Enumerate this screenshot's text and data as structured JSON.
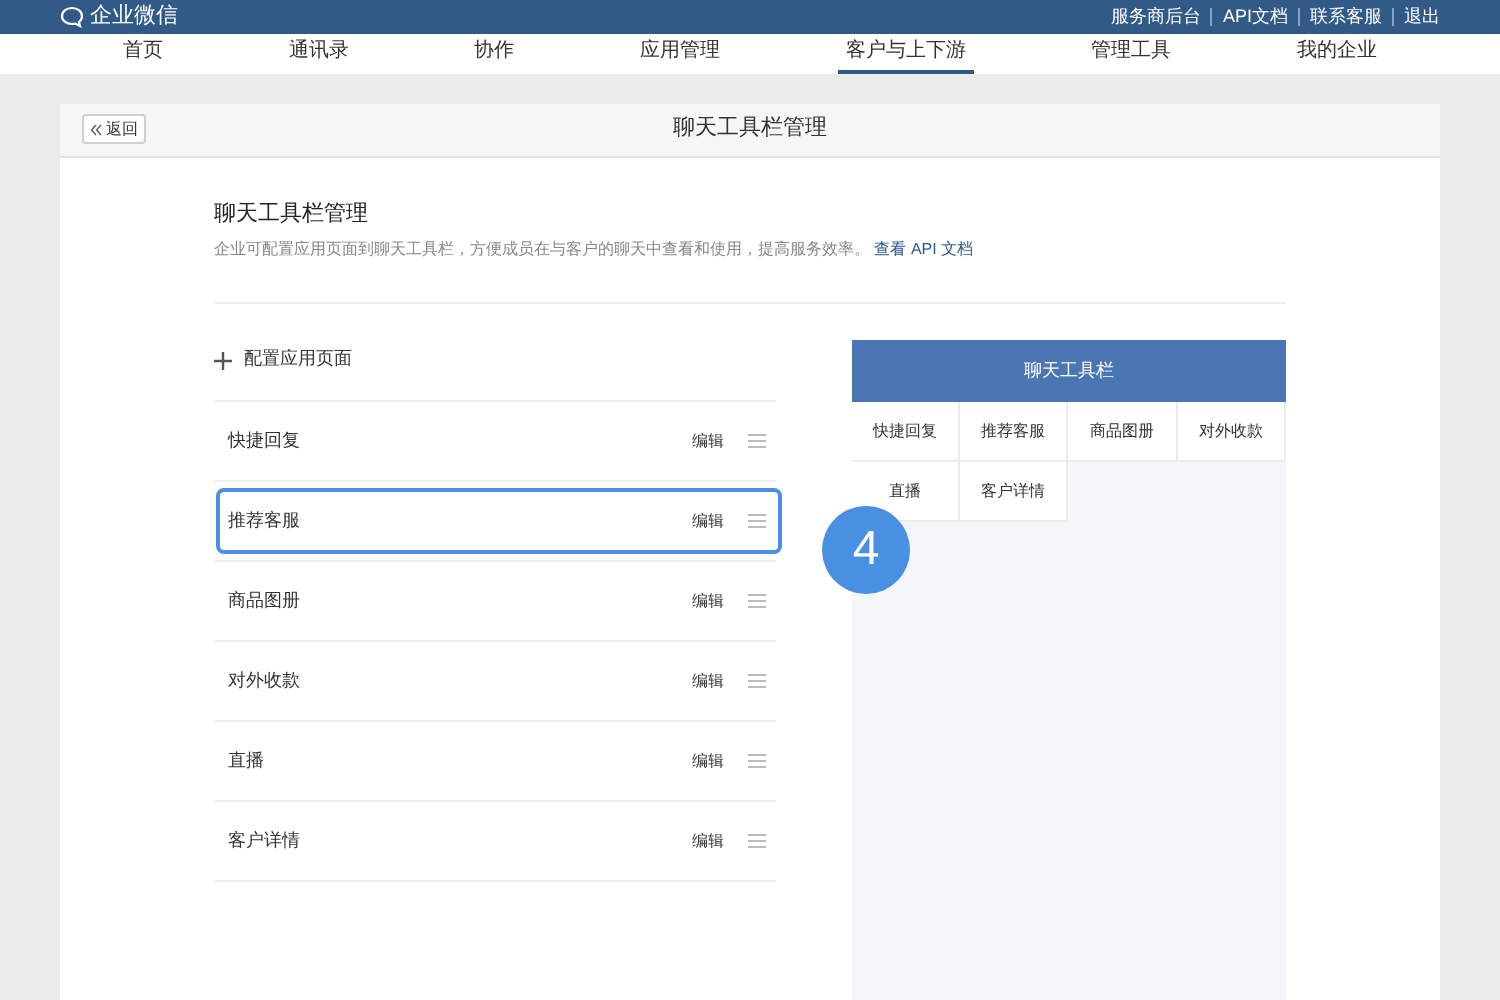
{
  "topbar": {
    "logo": "企业微信",
    "links": [
      "服务商后台",
      "API文档",
      "联系客服",
      "退出"
    ]
  },
  "nav": [
    {
      "label": "首页",
      "selected": false
    },
    {
      "label": "通讯录",
      "selected": false
    },
    {
      "label": "协作",
      "selected": false
    },
    {
      "label": "应用管理",
      "selected": false
    },
    {
      "label": "客户与上下游",
      "selected": true
    },
    {
      "label": "管理工具",
      "selected": false
    },
    {
      "label": "我的企业",
      "selected": false
    }
  ],
  "header": {
    "back": "返回",
    "title": "聊天工具栏管理"
  },
  "section": {
    "title": "聊天工具栏管理",
    "description": "企业可配置应用页面到聊天工具栏，方便成员在与客户的聊天中查看和使用，提高服务效率。",
    "link": "查看 API 文档"
  },
  "add_button": "配置应用页面",
  "items": [
    {
      "name": "快捷回复",
      "edit": "编辑",
      "selected": false
    },
    {
      "name": "推荐客服",
      "edit": "编辑",
      "selected": true
    },
    {
      "name": "商品图册",
      "edit": "编辑",
      "selected": false
    },
    {
      "name": "对外收款",
      "edit": "编辑",
      "selected": false
    },
    {
      "name": "直播",
      "edit": "编辑",
      "selected": false
    },
    {
      "name": "客户详情",
      "edit": "编辑",
      "selected": false
    }
  ],
  "step_badge": "4",
  "preview": {
    "title": "聊天工具栏",
    "cells": [
      "快捷回复",
      "推荐客服",
      "商品图册",
      "对外收款",
      "直播",
      "客户详情"
    ]
  }
}
